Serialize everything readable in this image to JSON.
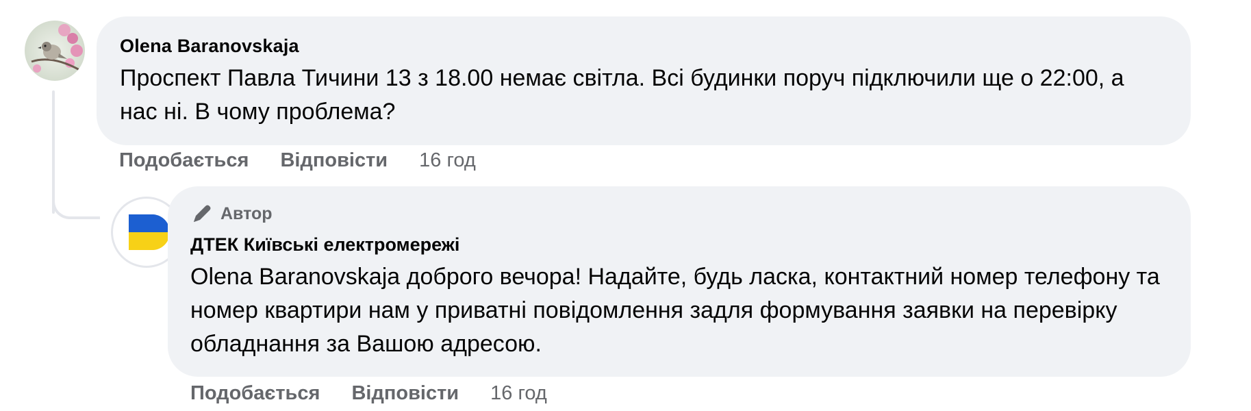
{
  "comment": {
    "author": "Olena Baranovskaja",
    "text": "Проспект Павла Тичини 13 з 18.00 немає світла. Всі будинки поруч підключили ще о 22:00, а нас ні. В чому проблема?",
    "actions": {
      "like": "Подобається",
      "reply": "Відповісти",
      "time": "16 год"
    }
  },
  "reply": {
    "badge": "Автор",
    "author": "ДТЕК Київські електромережі",
    "mention": "Olena Baranovskaja",
    "text": " доброго вечора! Надайте, будь ласка, контактний номер телефону та номер квартири нам у приватні повідомлення задля формування заявки на перевірку обладнання за Вашою адресою.",
    "actions": {
      "like": "Подобається",
      "reply": "Відповісти",
      "time": "16 год"
    }
  },
  "colors": {
    "bubble": "#f0f2f5",
    "secondary_text": "#65676b",
    "flag_blue": "#1c5fd1",
    "flag_yellow": "#f7d117"
  },
  "icons": {
    "avatar_olena": "bird-on-blossom-avatar",
    "avatar_dtek": "ukraine-flag-avatar",
    "badge": "pen-icon"
  }
}
